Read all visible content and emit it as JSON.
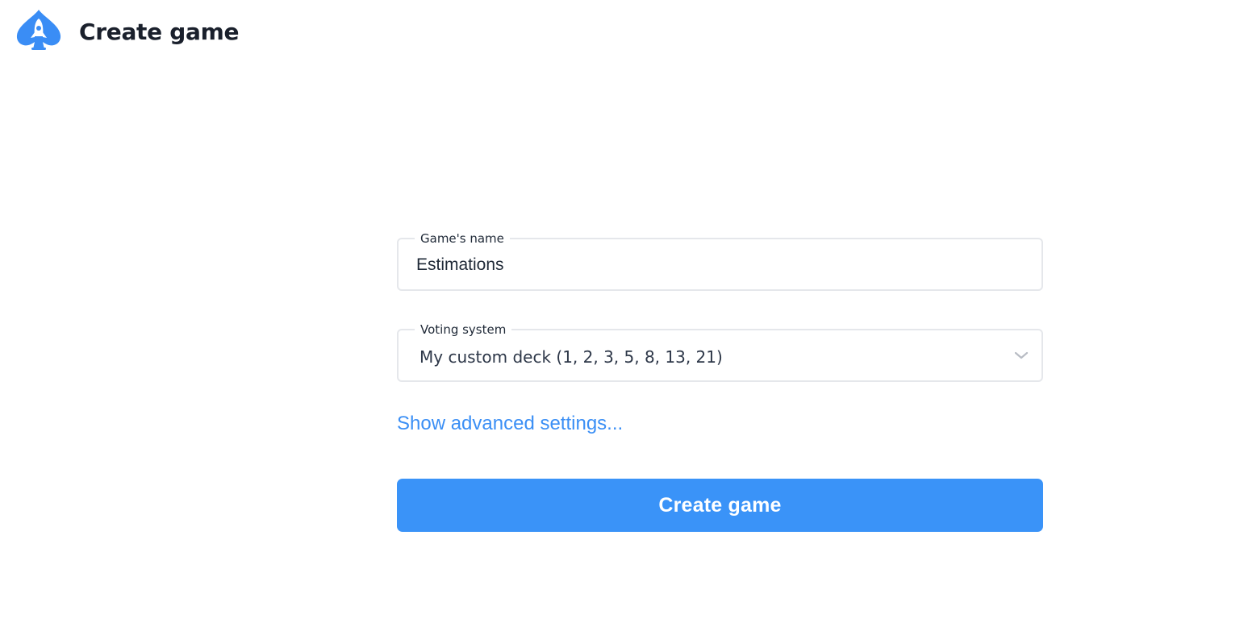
{
  "header": {
    "title": "Create game",
    "logo_icon": "rocket-spade-icon"
  },
  "form": {
    "name_field": {
      "label": "Game's name",
      "value": "Estimations"
    },
    "voting_field": {
      "label": "Voting system",
      "selected": "My custom deck (1, 2, 3, 5, 8, 13, 21)",
      "dropdown_icon": "chevron-down-icon"
    },
    "advanced_link": "Show advanced settings...",
    "submit_label": "Create game"
  },
  "colors": {
    "accent": "#3a93f8",
    "link": "#3b8ff5",
    "border": "#e5e7eb",
    "text": "#1f2937"
  }
}
